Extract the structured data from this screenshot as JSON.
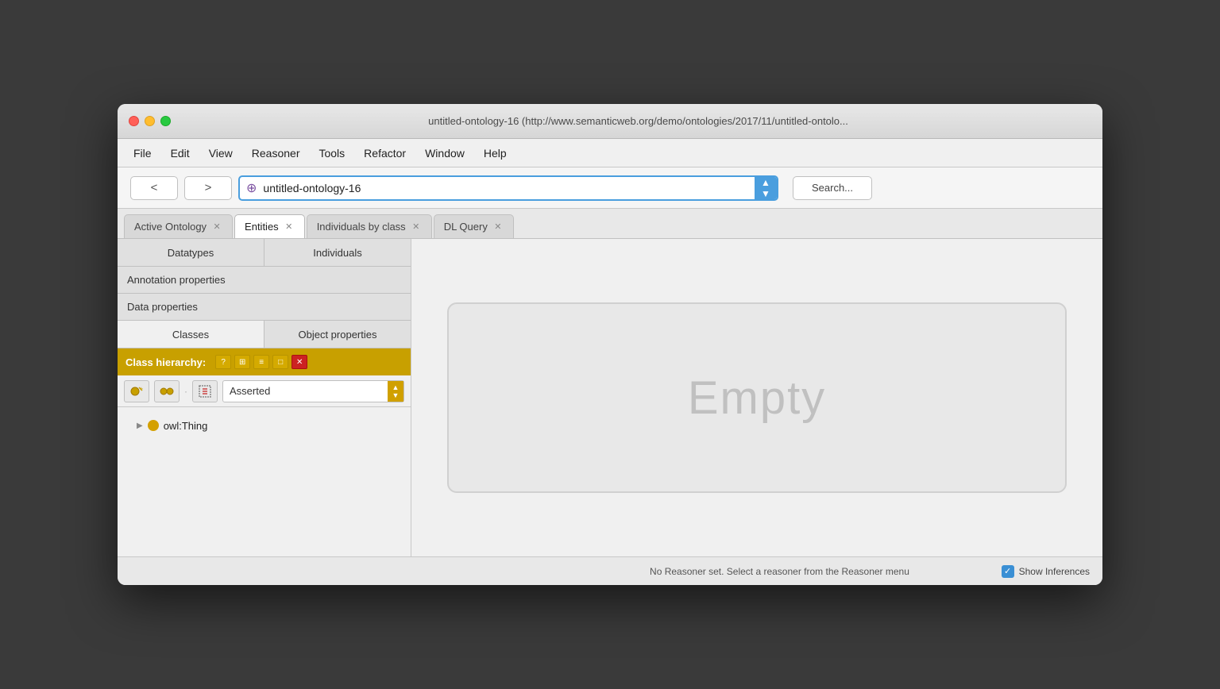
{
  "window": {
    "title": "untitled-ontology-16 (http://www.semanticweb.org/demo/ontologies/2017/11/untitled-ontolo..."
  },
  "menubar": {
    "items": [
      "File",
      "Edit",
      "View",
      "Reasoner",
      "Tools",
      "Refactor",
      "Window",
      "Help"
    ]
  },
  "toolbar": {
    "back_label": "<",
    "forward_label": ">",
    "address_value": "untitled-ontology-16",
    "address_icon": "⊕",
    "search_placeholder": "Search..."
  },
  "tabs": [
    {
      "label": "Active Ontology",
      "closeable": true,
      "active": false
    },
    {
      "label": "Entities",
      "closeable": true,
      "active": true
    },
    {
      "label": "Individuals by class",
      "closeable": true,
      "active": false
    },
    {
      "label": "DL Query",
      "closeable": true,
      "active": false
    }
  ],
  "left_panel": {
    "subtabs_row1": [
      "Datatypes",
      "Individuals"
    ],
    "subtabs_row2": "Annotation properties",
    "subtabs_row3": "Data properties",
    "classes_tabs": [
      "Classes",
      "Object properties"
    ],
    "hierarchy_header": "Class hierarchy:",
    "hierarchy_icons": [
      "?",
      "|||",
      "=",
      "□",
      "✕"
    ],
    "asserted_label": "Asserted",
    "tree_item": "owl:Thing"
  },
  "right_panel": {
    "empty_label": "Empty"
  },
  "statusbar": {
    "message": "No Reasoner set. Select a reasoner from the Reasoner menu",
    "show_inferences_label": "Show Inferences",
    "checkbox_checked": true
  }
}
